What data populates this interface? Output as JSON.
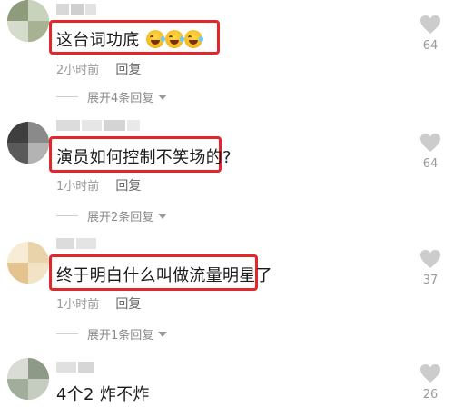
{
  "comments": [
    {
      "text": "这台词功底",
      "time": "2小时前",
      "reply_label": "回复",
      "expand_label": "展开4条回复",
      "likes": "64",
      "emoji": "laugh-cry-emoji"
    },
    {
      "text": "演员如何控制不笑场的?",
      "time": "1小时前",
      "reply_label": "回复",
      "expand_label": "展开2条回复",
      "likes": "64"
    },
    {
      "text": "终于明白什么叫做流量明星了",
      "time": "1小时前",
      "reply_label": "回复",
      "expand_label": "展开1条回复",
      "likes": "37"
    },
    {
      "text": "4个2 炸不炸",
      "likes": "26"
    }
  ],
  "colors": {
    "highlight_box": "#e3262a",
    "meta_text": "#9a9a9a",
    "like_icon": "#cccccc"
  },
  "icons": {
    "like": "heart-icon",
    "expand": "caret-down-icon"
  }
}
